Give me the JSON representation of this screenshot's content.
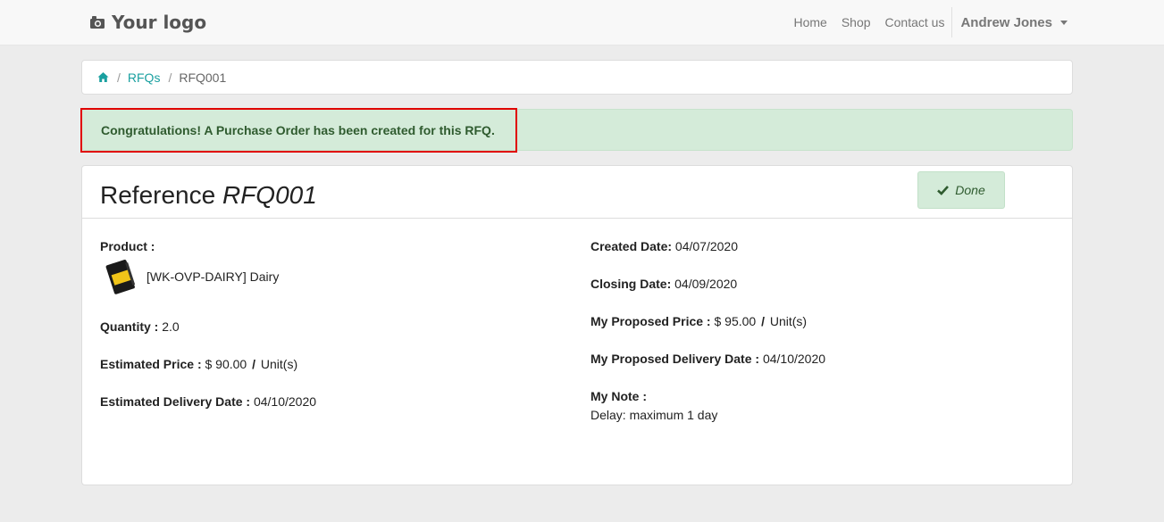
{
  "navbar": {
    "logo_text": "Your logo",
    "logo_icon": "camera-icon",
    "links": [
      "Home",
      "Shop",
      "Contact us"
    ],
    "user_name": "Andrew Jones"
  },
  "breadcrumb": {
    "home_icon": "home-icon",
    "separator": "/",
    "parent_label": "RFQs",
    "current_label": "RFQ001"
  },
  "alert": {
    "message": "Congratulations! A Purchase Order has been created for this RFQ."
  },
  "panel": {
    "title_prefix": "Reference",
    "title_ref": "RFQ001",
    "status_button": "Done"
  },
  "left": {
    "product_label": "Product :",
    "product_name": "[WK-OVP-DAIRY] Dairy",
    "quantity_label": "Quantity :",
    "quantity_value": "2.0",
    "est_price_label": "Estimated Price :",
    "est_price_value": "$ 90.00",
    "est_price_unit": "Unit(s)",
    "est_delivery_label": "Estimated Delivery Date :",
    "est_delivery_value": "04/10/2020"
  },
  "right": {
    "created_label": "Created Date:",
    "created_value": "04/07/2020",
    "closing_label": "Closing Date:",
    "closing_value": "04/09/2020",
    "proposed_price_label": "My Proposed Price :",
    "proposed_price_value": "$ 95.00",
    "proposed_price_unit": "Unit(s)",
    "proposed_delivery_label": "My Proposed Delivery Date :",
    "proposed_delivery_value": "04/10/2020",
    "note_label": "My Note :",
    "note_value": "Delay: maximum 1 day"
  },
  "colors": {
    "accent_link": "#1aa0a0",
    "success_bg": "#d4ebd9",
    "success_text": "#2f5b2f",
    "highlight": "#e00000"
  }
}
